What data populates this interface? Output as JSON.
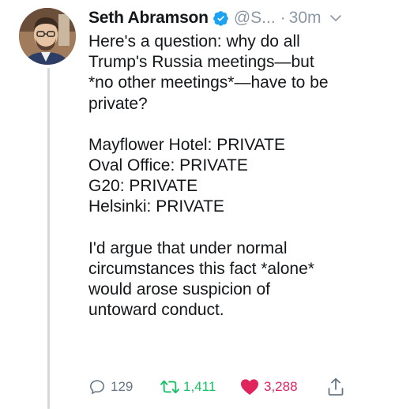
{
  "tweet": {
    "author": {
      "display_name": "Seth Abramson",
      "handle": "@S...",
      "verified": true
    },
    "separator": "·",
    "timestamp": "30m",
    "body": {
      "paragraph_1": [
        "Here's a question: why do all",
        "Trump's Russia meetings—but",
        "*no other meetings*—have to be",
        "private?"
      ],
      "paragraph_2": [
        "Mayflower Hotel: PRIVATE",
        "Oval Office: PRIVATE",
        "G20: PRIVATE",
        "Helsinki: PRIVATE"
      ],
      "paragraph_3": [
        "I'd argue that under normal",
        "circumstances this fact *alone*",
        "would arose suspicion of",
        "untoward conduct."
      ]
    },
    "actions": {
      "reply_count": "129",
      "retweet_count": "1,411",
      "like_count": "3,288"
    },
    "colors": {
      "verified_blue": "#1da1f2",
      "retweet_green": "#17bf63",
      "like_red": "#e0245e",
      "muted_gray": "#8b98a5"
    },
    "icons": [
      "verified-badge-icon",
      "chevron-down-icon",
      "reply-icon",
      "retweet-icon",
      "heart-icon",
      "share-icon"
    ]
  }
}
